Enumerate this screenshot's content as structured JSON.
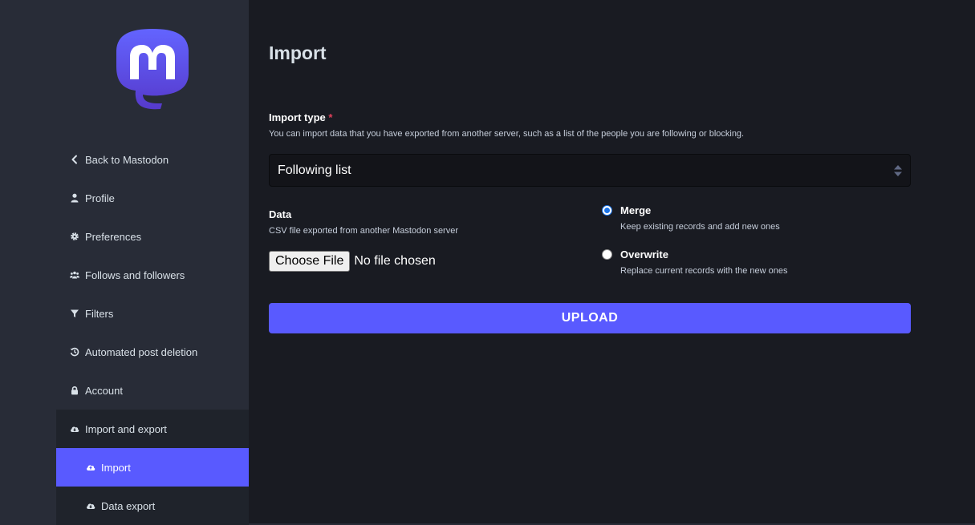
{
  "sidebar": {
    "logo_icon": "mastodon-logo-icon",
    "items": [
      {
        "label": "Back to Mastodon",
        "icon": "chevron-left-icon"
      },
      {
        "label": "Profile",
        "icon": "user-icon"
      },
      {
        "label": "Preferences",
        "icon": "gear-icon"
      },
      {
        "label": "Follows and followers",
        "icon": "users-icon"
      },
      {
        "label": "Filters",
        "icon": "filter-icon"
      },
      {
        "label": "Automated post deletion",
        "icon": "history-icon"
      },
      {
        "label": "Account",
        "icon": "lock-icon"
      },
      {
        "label": "Import and export",
        "icon": "cloud-download-icon"
      },
      {
        "label": "Import",
        "icon": "cloud-upload-icon"
      },
      {
        "label": "Data export",
        "icon": "cloud-download-icon"
      }
    ],
    "active_item": "Import"
  },
  "main": {
    "title": "Import",
    "import_type": {
      "label": "Import type",
      "required_mark": "*",
      "hint": "You can import data that you have exported from another server, such as a list of the people you are following or blocking.",
      "selected": "Following list"
    },
    "data": {
      "label": "Data",
      "hint": "CSV file exported from another Mastodon server",
      "choose_file_label": "Choose File",
      "no_file_text": "No file chosen"
    },
    "mode": {
      "selected": "Merge",
      "options": [
        {
          "label": "Merge",
          "hint": "Keep existing records and add new ones",
          "checked": true
        },
        {
          "label": "Overwrite",
          "hint": "Replace current records with the new ones",
          "checked": false
        }
      ]
    },
    "upload_label": "UPLOAD"
  },
  "colors": {
    "accent": "#595aff",
    "sidebar_bg": "#282c37",
    "main_bg": "#191b22",
    "required": "#df405a"
  }
}
